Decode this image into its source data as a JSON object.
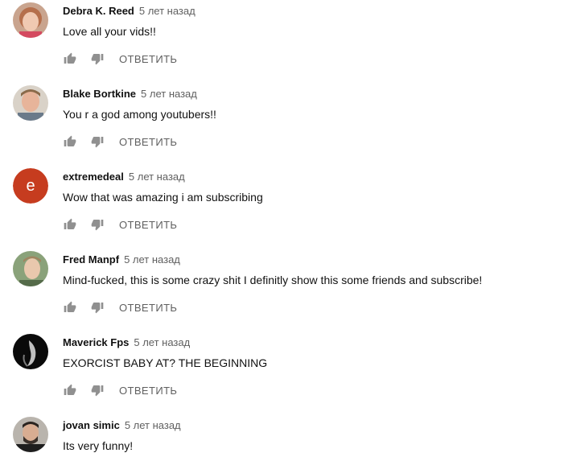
{
  "reply_label": "ОТВЕТИТЬ",
  "comments": [
    {
      "author": "Debra K. Reed",
      "time": "5 лет назад",
      "text": "Love all your vids!!"
    },
    {
      "author": "Blake Bortkine",
      "time": "5 лет назад",
      "text": "You r a god among youtubers!!"
    },
    {
      "author": "extremedeal",
      "time": "5 лет назад",
      "text": "Wow that was amazing i am subscribing",
      "avatar_letter": "e",
      "avatar_color": "#c63c1f"
    },
    {
      "author": "Fred Manpf",
      "time": "5 лет назад",
      "text": "Mind-fucked, this is some crazy shit I definitly show this some friends and subscribe!"
    },
    {
      "author": "Maverick Fps",
      "time": "5 лет назад",
      "text": "EXORCIST BABY AT? THE BEGINNING"
    },
    {
      "author": "jovan simic",
      "time": "5 лет назад",
      "text": "Its very funny!"
    }
  ],
  "colors": {
    "author": "#111111",
    "meta": "#606060",
    "icon": "#909090"
  },
  "icons": {
    "like": "thumb-up-icon",
    "dislike": "thumb-down-icon"
  }
}
